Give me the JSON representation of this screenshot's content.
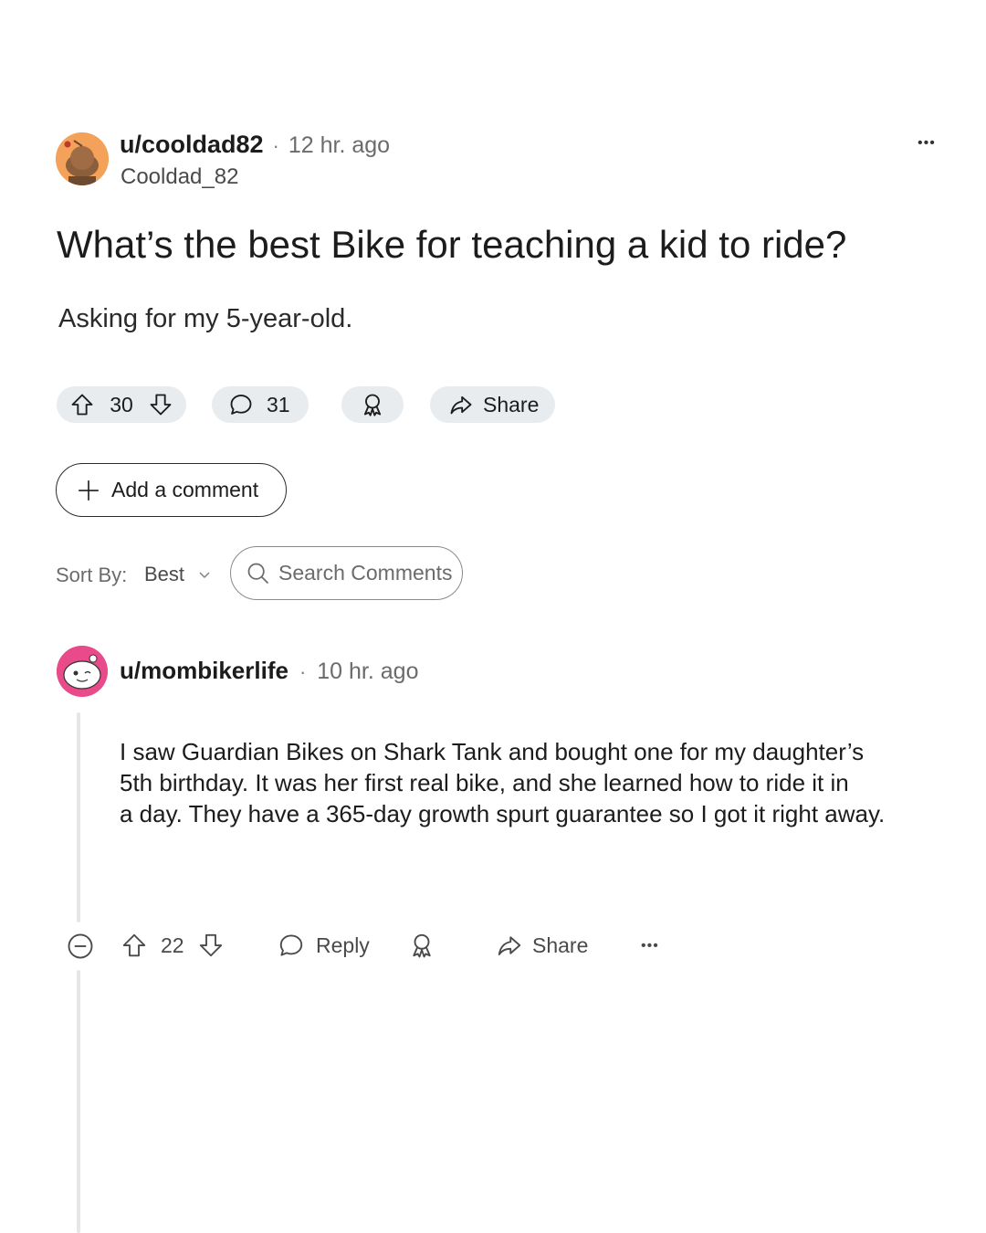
{
  "post": {
    "username": "u/cooldad82",
    "separator": "·",
    "time": "12 hr. ago",
    "display_name": "Cooldad_82",
    "title": "What’s the best Bike for teaching a kid to ride?",
    "body": "Asking for my 5-year-old.",
    "upvotes": "30",
    "comments": "31",
    "share_label": "Share",
    "more_label": "•••"
  },
  "add_comment_label": "Add a comment",
  "sort": {
    "label": "Sort By:",
    "value": "Best"
  },
  "search": {
    "placeholder": "Search Comments"
  },
  "comment": {
    "username": "u/mombikerlife",
    "separator": "·",
    "time": "10 hr. ago",
    "body_lines": [
      "I saw Guardian Bikes on Shark Tank and bought one for my daughter’s",
      "5th birthday. It was her first real bike, and she learned how to ride it in",
      "a day. They have a 365-day growth spurt guarantee so I got it right away."
    ],
    "upvotes": "22",
    "reply_label": "Reply",
    "share_label": "Share",
    "more_label": "•••"
  },
  "colors": {
    "pill_bg": "#e8ecef",
    "op_avatar": "#f4a259",
    "commenter_avatar": "#e84a8a"
  },
  "icons": [
    "snoo-avatar-icon",
    "upvote-icon",
    "downvote-icon",
    "comment-icon",
    "award-icon",
    "share-icon",
    "plus-icon",
    "chevron-down-icon",
    "search-icon",
    "collapse-icon",
    "more-icon"
  ]
}
